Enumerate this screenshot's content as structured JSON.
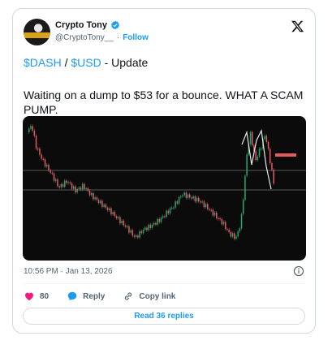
{
  "author": {
    "name": "Crypto Tony",
    "handle": "@CryptoTony__",
    "separator": "·",
    "follow_label": "Follow"
  },
  "tweet": {
    "cashtag_base": "$DASH",
    "pair_sep": " / ",
    "cashtag_quote": "$USD",
    "title_suffix": " - Update",
    "body": "Waiting on a dump to $53 for a bounce. WHAT A SCAM PUMP.",
    "timestamp": "10:56 PM · Jan 13, 2026"
  },
  "actions": {
    "likes_count": "80",
    "reply_label": "Reply",
    "copy_link_label": "Copy link",
    "read_replies_label": "Read 36 replies"
  },
  "icons": {
    "verified": "verified-badge-icon",
    "x_logo": "x-logo-icon",
    "info": "info-icon",
    "heart": "heart-icon",
    "reply": "reply-icon",
    "link": "link-icon"
  },
  "colors": {
    "accent": "#1d9bf0",
    "heart": "#f91880",
    "chart_bg": "#0b0b0c",
    "candle_up": "#22a96f",
    "candle_down": "#e35a63"
  }
}
